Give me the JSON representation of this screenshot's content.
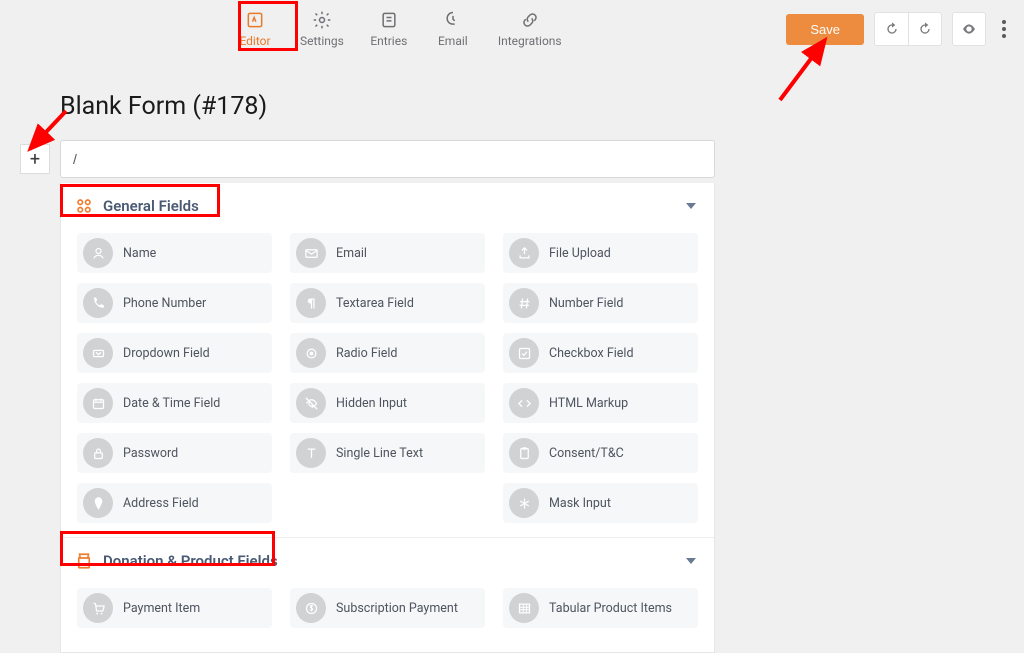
{
  "nav": {
    "tabs": [
      {
        "label": "Editor",
        "active": true
      },
      {
        "label": "Settings",
        "active": false
      },
      {
        "label": "Entries",
        "active": false
      },
      {
        "label": "Email",
        "active": false
      },
      {
        "label": "Integrations",
        "active": false
      }
    ],
    "save_label": "Save"
  },
  "page": {
    "title": "Blank Form (#178)",
    "slash_value": "/"
  },
  "sections": [
    {
      "title": "General Fields",
      "items": [
        "Name",
        "Email",
        "File Upload",
        "Phone Number",
        "Textarea Field",
        "Number Field",
        "Dropdown Field",
        "Radio Field",
        "Checkbox Field",
        "Date & Time Field",
        "Hidden Input",
        "HTML Markup",
        "Password",
        "Single Line Text",
        "Consent/T&C",
        "Address Field",
        "",
        "Mask Input"
      ]
    },
    {
      "title": "Donation & Product Fields",
      "items": [
        "Payment Item",
        "Subscription Payment",
        "Tabular Product Items"
      ]
    }
  ],
  "icons": {
    "general": [
      "user",
      "mail",
      "upload",
      "phone",
      "para",
      "hash",
      "chev",
      "radio",
      "check",
      "calendar",
      "eye-off",
      "code",
      "lock",
      "text",
      "clip",
      "pin",
      "",
      "asterisk"
    ],
    "donation": [
      "cart",
      "dollar",
      "grid"
    ]
  }
}
